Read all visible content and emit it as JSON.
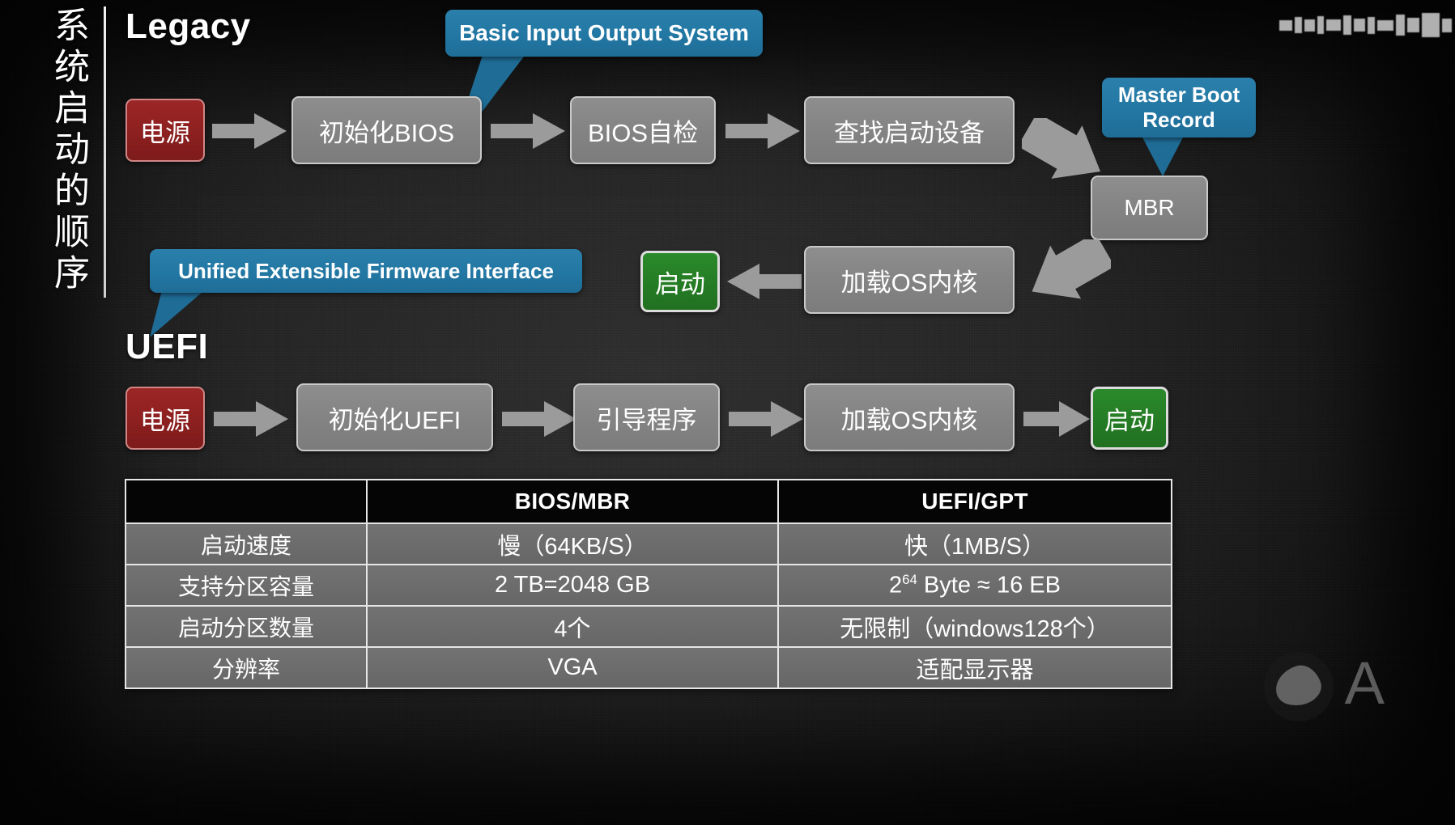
{
  "page": {
    "vertical_title": "系统启动的顺序",
    "background_color": "#1c1c1c",
    "accent_blue": "#2277a3",
    "accent_red": "#8e2020",
    "accent_green": "#257d25",
    "node_gray": "#848484"
  },
  "sections": {
    "legacy_heading": "Legacy",
    "uefi_heading": "UEFI"
  },
  "callouts": {
    "bios": "Basic Input Output System",
    "mbr_line1": "Master Boot",
    "mbr_line2": "Record",
    "uefi": "Unified Extensible Firmware Interface"
  },
  "legacy_flow": {
    "power": "电源",
    "init_bios": "初始化BIOS",
    "post": "BIOS自检",
    "find_device": "查找启动设备",
    "mbr": "MBR",
    "load_kernel": "加载OS内核",
    "boot": "启动"
  },
  "uefi_flow": {
    "power": "电源",
    "init_uefi": "初始化UEFI",
    "bootloader": "引导程序",
    "load_kernel": "加载OS内核",
    "boot": "启动"
  },
  "comparison_table": {
    "headers": [
      "",
      "BIOS/MBR",
      "UEFI/GPT"
    ],
    "rows": [
      {
        "label": "启动速度",
        "bios": "慢（64KB/S）",
        "uefi": "快（1MB/S）"
      },
      {
        "label": "支持分区容量",
        "bios": "2 TB=2048 GB",
        "uefi_base": "2",
        "uefi_exp": "64",
        "uefi_rest": " Byte ≈ 16 EB"
      },
      {
        "label": "启动分区数量",
        "bios": "4个",
        "uefi": "无限制（windows128个）"
      },
      {
        "label": "分辨率",
        "bios": "VGA",
        "uefi": "适配显示器"
      }
    ]
  },
  "watermark": {
    "letter": "A"
  }
}
